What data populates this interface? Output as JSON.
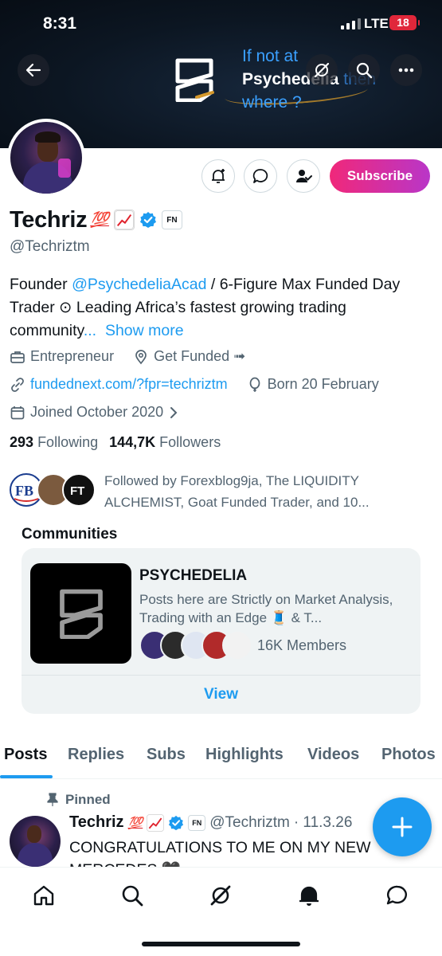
{
  "status_bar": {
    "time": "8:31",
    "network": "LTE",
    "battery": "18"
  },
  "banner": {
    "line1": "If not at",
    "line2_bold": "Psychedelia",
    "line2_rest": " then",
    "line3": "where ?"
  },
  "profile": {
    "display_name": "Techriz",
    "name_emoji": "💯",
    "handle": "@Techriztm",
    "bio_prefix": "Founder ",
    "bio_mention": "@PsychedeliaAcad",
    "bio_rest": " / 6-Figure Max Funded Day Trader ⊙ Leading Africa’s fastest growing trading community",
    "bio_ellipsis": "...",
    "show_more": "Show more",
    "category": "Entrepreneur",
    "location": "Get Funded ➟",
    "website": "fundednext.com/?fpr=techriztm",
    "birthday": "Born 20 February",
    "joined": "Joined October 2020",
    "following_count": "293",
    "following_label": "Following",
    "followers_count": "144,7K",
    "followers_label": "Followers",
    "followed_by": "Followed by Forexblog9ja, The LIQUIDITY ALCHEMIST, Goat Funded Trader, and 10..."
  },
  "buttons": {
    "subscribe": "Subscribe",
    "fn_badge": "FN"
  },
  "communities": {
    "title": "Communities",
    "name": "PSYCHEDELIA",
    "description": "Posts here are Strictly on Market Analysis, Trading with an Edge 🧵 & T...",
    "members": "16K Members",
    "view": "View"
  },
  "tabs": [
    "Posts",
    "Replies",
    "Subs",
    "Highlights",
    "Videos",
    "Photos"
  ],
  "post": {
    "pinned_label": "Pinned",
    "name": "Techriz",
    "name_emoji": "💯",
    "handle": "@Techriztm",
    "date": "· 11.3.26",
    "text": "CONGRATULATIONS TO ME ON MY NEW MERCEDES 🖤"
  },
  "colors": {
    "accent": "#1d9bf0",
    "subscribe_start": "#f0287a",
    "subscribe_end": "#b936c8",
    "battery": "#e0273a"
  },
  "icons": [
    "back-arrow-icon",
    "grok-icon",
    "search-icon",
    "more-icon",
    "bell-plus-icon",
    "message-icon",
    "person-check-icon",
    "verified-icon",
    "briefcase-icon",
    "location-pin-icon",
    "link-icon",
    "balloon-icon",
    "calendar-icon",
    "chevron-right-icon",
    "pin-icon",
    "compose-plus-icon",
    "home-icon",
    "explore-icon",
    "grok-nav-icon",
    "notifications-icon",
    "messages-icon"
  ]
}
